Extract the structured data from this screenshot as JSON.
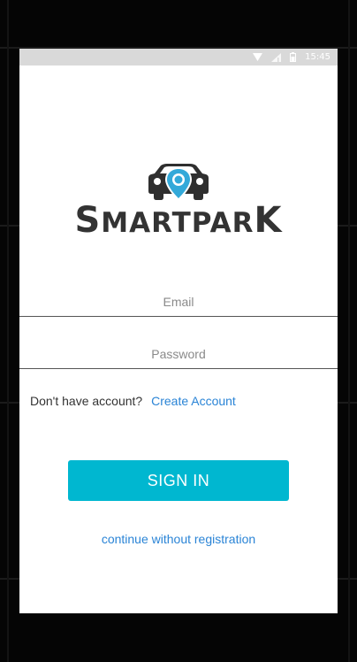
{
  "status_bar": {
    "time": "15:45",
    "icons": [
      "wifi-icon",
      "signal-icon",
      "battery-icon"
    ]
  },
  "logo": {
    "text": "SMARTPARK",
    "icon": "car-location-pin-icon",
    "accent_color": "#33a9d9"
  },
  "login_form": {
    "email_placeholder": "Email",
    "password_placeholder": "Password",
    "account_prompt": "Don't have account?",
    "create_account_label": "Create Account",
    "sign_in_label": "SIGN IN",
    "continue_label": "continue without registration"
  },
  "colors": {
    "primary_button": "#00b7d0",
    "link": "#2a84d6",
    "text": "#333333"
  }
}
